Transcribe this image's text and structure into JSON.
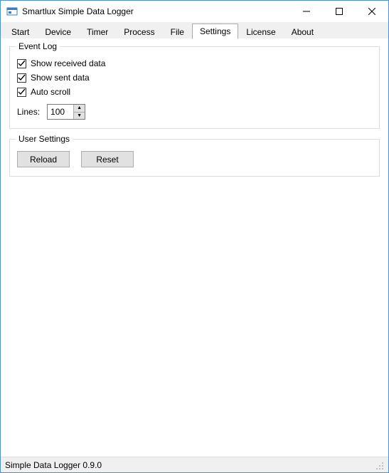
{
  "window": {
    "title": "Smartlux Simple Data Logger"
  },
  "tabs": [
    {
      "label": "Start"
    },
    {
      "label": "Device"
    },
    {
      "label": "Timer"
    },
    {
      "label": "Process"
    },
    {
      "label": "File"
    },
    {
      "label": "Settings",
      "active": true
    },
    {
      "label": "License"
    },
    {
      "label": "About"
    }
  ],
  "settings": {
    "event_log": {
      "title": "Event Log",
      "show_received": {
        "label": "Show received data",
        "checked": true
      },
      "show_sent": {
        "label": "Show sent data",
        "checked": true
      },
      "auto_scroll": {
        "label": "Auto scroll",
        "checked": true
      },
      "lines_label": "Lines:",
      "lines_value": "100"
    },
    "user_settings": {
      "title": "User Settings",
      "reload_label": "Reload",
      "reset_label": "Reset"
    }
  },
  "statusbar": {
    "text": "Simple Data Logger 0.9.0"
  }
}
